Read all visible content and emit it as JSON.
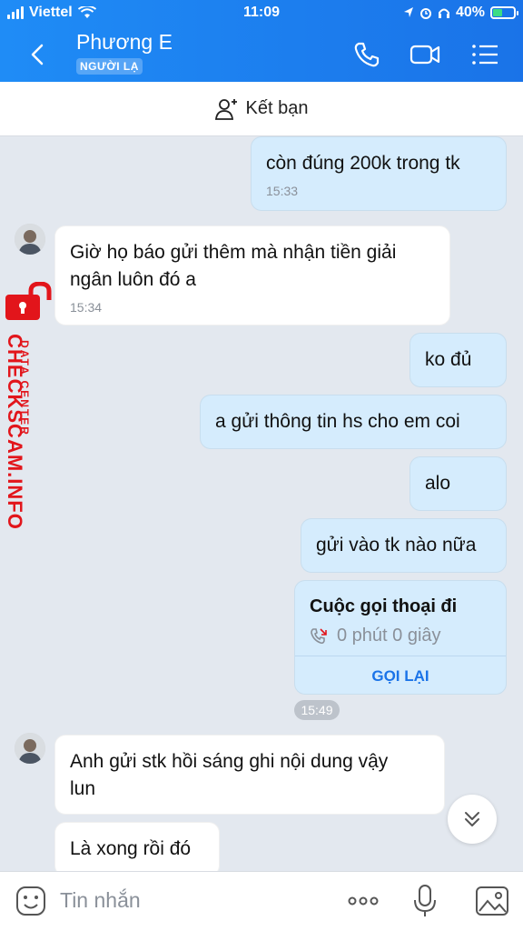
{
  "status_bar": {
    "carrier": "Viettel",
    "time": "11:09",
    "battery": "40%"
  },
  "header": {
    "contact_name": "Phương E",
    "badge": "NGƯỜI LẠ"
  },
  "friend_bar": {
    "label": "Kết bạn"
  },
  "messages": [
    {
      "side": "mine",
      "text": "còn đúng 200k trong tk",
      "time": "15:33"
    },
    {
      "side": "theirs",
      "text_line1": "Giờ họ báo gửi thêm mà nhận tiền giải",
      "text_line2": "ngân luôn đó a",
      "time": "15:34"
    },
    {
      "side": "mine",
      "text": "ko đủ"
    },
    {
      "side": "mine",
      "text": "a gửi thông tin hs cho em coi"
    },
    {
      "side": "mine",
      "text": "alo"
    },
    {
      "side": "mine",
      "text": "gửi vào tk nào nữa"
    },
    {
      "side": "theirs",
      "text_line1": "Anh gửi stk hồi sáng ghi nội dung vậy",
      "text_line2": "lun"
    },
    {
      "side": "theirs",
      "text": "Là xong rồi đó"
    }
  ],
  "call_card": {
    "title": "Cuộc gọi thoại đi",
    "duration": "0 phút 0 giây",
    "action": "GỌI LẠI"
  },
  "time_chip": "15:49",
  "watermark": {
    "brand": "CHECKSCAM.INFO",
    "subtitle": "DATA CENTER"
  },
  "composer": {
    "placeholder": "Tin nhắn"
  },
  "colors": {
    "header": "#1a73e8",
    "mine_bubble": "#d5ecfd",
    "theirs_bubble": "#ffffff",
    "background": "#e3e8ef",
    "watermark": "#e2151b"
  }
}
